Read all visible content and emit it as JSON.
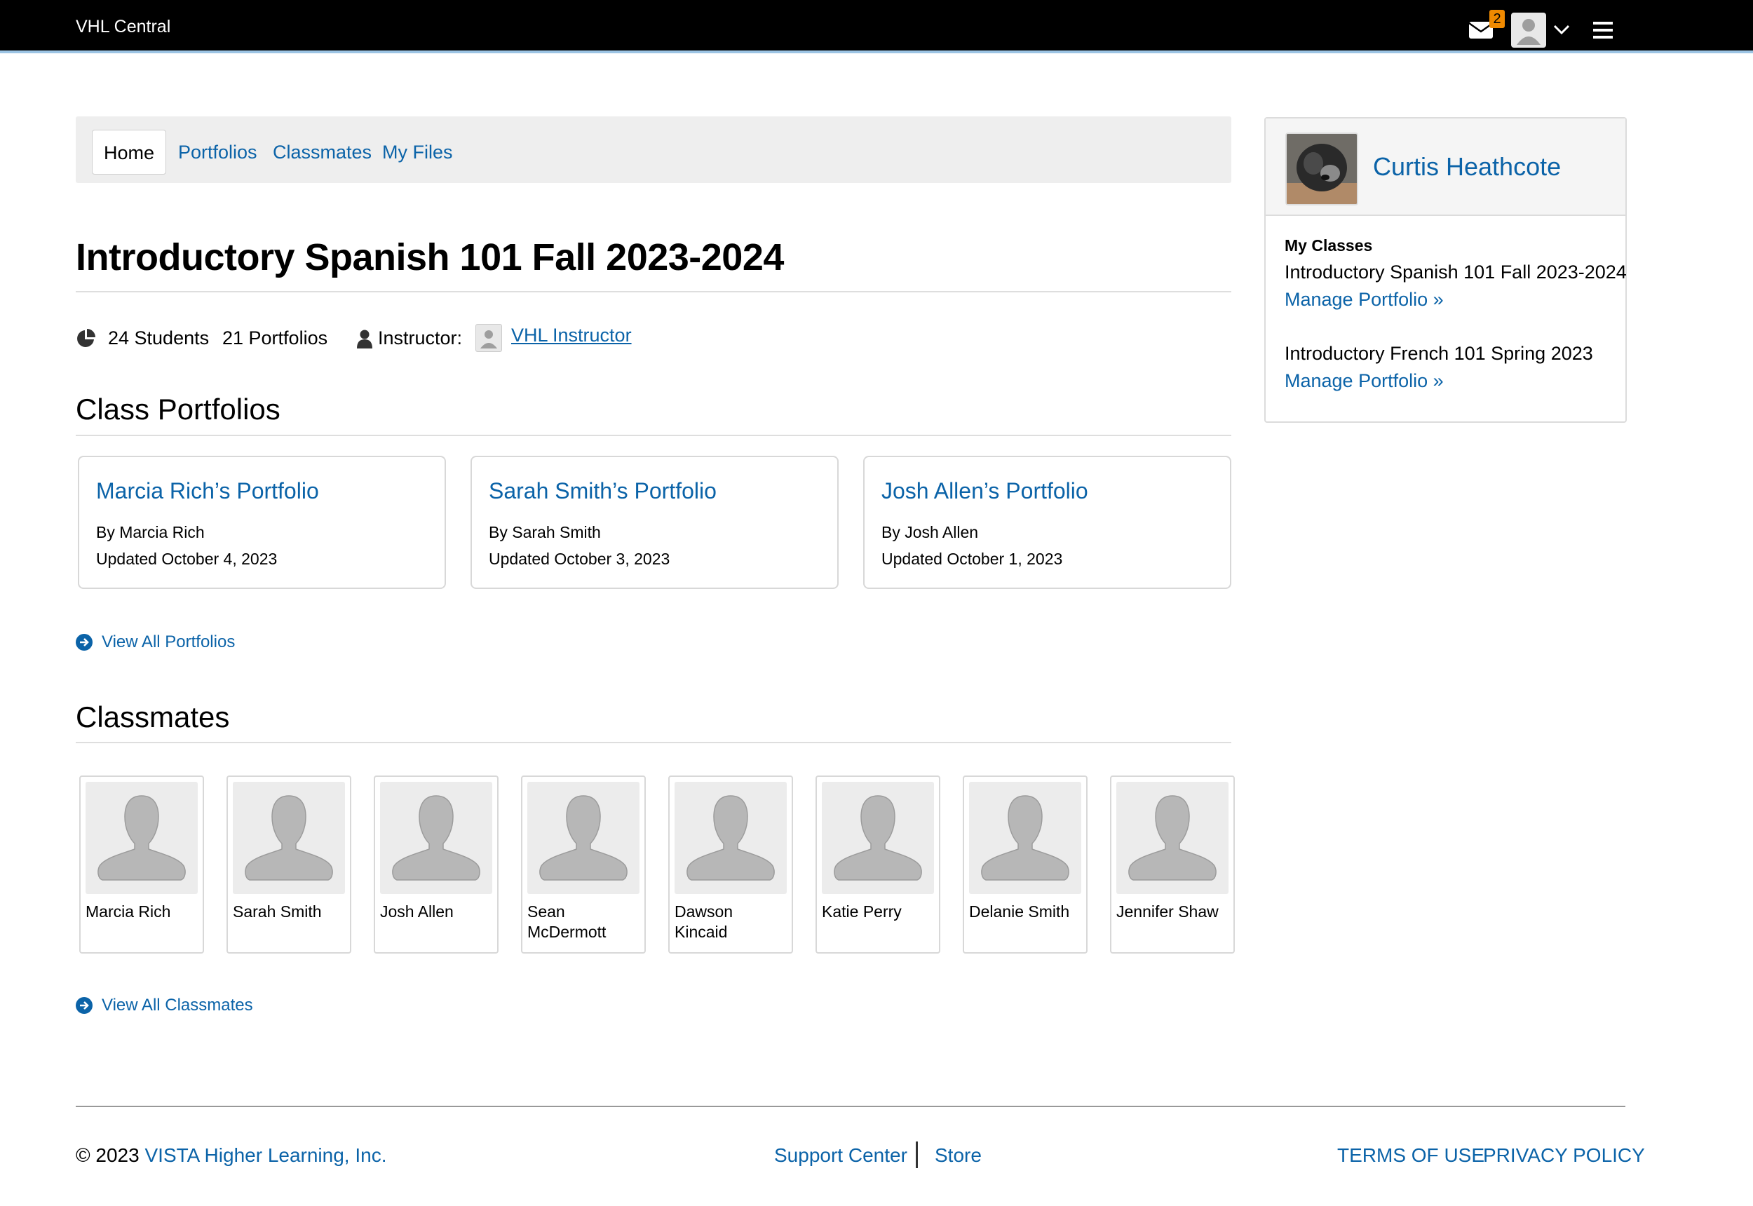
{
  "topbar": {
    "brand": "VHL Central",
    "mail_count": "2"
  },
  "tabs": [
    {
      "label": "Home",
      "active": true
    },
    {
      "label": "Portfolios"
    },
    {
      "label": "Classmates"
    },
    {
      "label": "My Files"
    }
  ],
  "course": {
    "title": "Introductory Spanish 101 Fall 2023-2024",
    "students": "24 Students",
    "portfolios": "21 Portfolios",
    "instructor_label": "Instructor:",
    "instructor_name": "VHL Instructor"
  },
  "portfolios_section": {
    "title": "Class Portfolios",
    "cards": [
      {
        "title": "Marcia Rich’s Portfolio",
        "by": "By Marcia Rich",
        "updated": "Updated October 4, 2023"
      },
      {
        "title": "Sarah Smith’s Portfolio",
        "by": "By Sarah Smith",
        "updated": "Updated October 3, 2023"
      },
      {
        "title": "Josh Allen’s Portfolio",
        "by": "By Josh Allen",
        "updated": "Updated October 1, 2023"
      }
    ],
    "view_all": "View All Portfolios"
  },
  "classmates_section": {
    "title": "Classmates",
    "people": [
      {
        "name": "Marcia Rich"
      },
      {
        "name": "Sarah Smith"
      },
      {
        "name": "Josh Allen"
      },
      {
        "name": "Sean McDermott"
      },
      {
        "name": "Dawson Kincaid"
      },
      {
        "name": "Katie Perry"
      },
      {
        "name": "Delanie Smith"
      },
      {
        "name": "Jennifer Shaw"
      }
    ],
    "view_all": "View All Classmates"
  },
  "sidebar": {
    "user_name": "Curtis Heathcote",
    "my_classes_label": "My Classes",
    "classes": [
      {
        "name": "Introductory Spanish 101 Fall 2023-2024",
        "link": "Manage Portfolio »"
      },
      {
        "name": "Introductory French 101 Spring 2023",
        "link": "Manage Portfolio »"
      }
    ]
  },
  "footer": {
    "copyright": "© 2023",
    "company": "VISTA Higher Learning, Inc.",
    "support": "Support Center",
    "store": "Store",
    "terms": "TERMS OF USE",
    "privacy": "PRIVACY POLICY"
  },
  "colors": {
    "link": "#0b63a8",
    "topbar": "#000000",
    "badge": "#f08a00"
  }
}
